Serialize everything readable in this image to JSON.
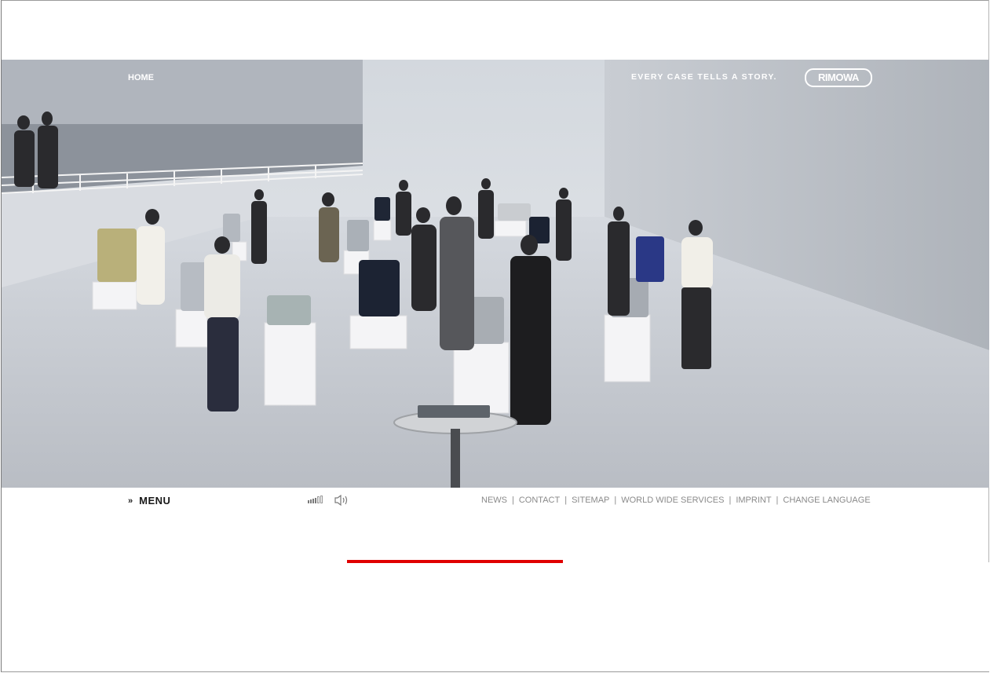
{
  "header": {
    "home_label": "HOME",
    "tagline": "EVERY CASE TELLS A STORY.",
    "logo_text": "RIMOWA"
  },
  "stage": {
    "scene": "showroom-gallery-image"
  },
  "footer": {
    "menu_marker": "»",
    "menu_label": "MENU",
    "volume_level": 0.67,
    "links": [
      {
        "label": "NEWS"
      },
      {
        "label": "CONTACT"
      },
      {
        "label": "SITEMAP"
      },
      {
        "label": "WORLD WIDE SERVICES"
      },
      {
        "label": "IMPRINT"
      },
      {
        "label": "CHANGE LANGUAGE"
      }
    ],
    "link_separator": "|"
  },
  "loading": {
    "progress": 1.0,
    "color": "#e00000"
  },
  "colors": {
    "accent": "#e00000",
    "link_gray": "#8a8a8a"
  },
  "icons": {
    "volume": "volume-bars-icon",
    "speaker": "speaker-icon"
  }
}
